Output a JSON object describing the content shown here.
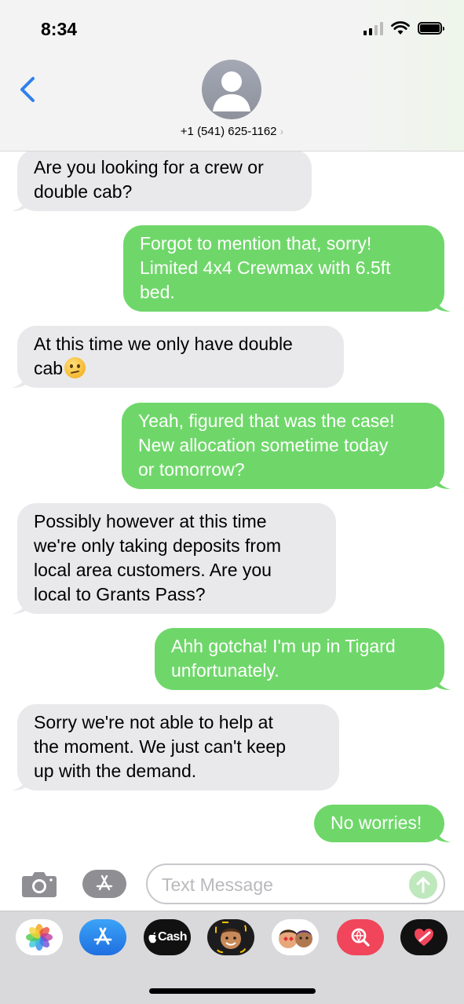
{
  "status_bar": {
    "time": "8:34"
  },
  "header": {
    "back_icon": "chevron-left-icon",
    "avatar_icon": "person-icon",
    "contact": "+1 (541) 625-1162",
    "chevron": "›"
  },
  "messages": [
    {
      "direction": "in",
      "lines": [
        "Are you looking for a crew or",
        "double cab?"
      ]
    },
    {
      "direction": "out",
      "lines": [
        "Forgot to mention that, sorry!",
        "Limited 4x4 Crewmax with 6.5ft",
        "bed."
      ]
    },
    {
      "direction": "in",
      "lines": [
        "At this time we only have double",
        "cab"
      ],
      "emoji": "confused-face-emoji"
    },
    {
      "direction": "out",
      "lines": [
        "Yeah, figured that was the case!",
        "New allocation sometime today",
        "or tomorrow?"
      ]
    },
    {
      "direction": "in",
      "lines": [
        "Possibly however at this time",
        "we're only taking deposits from",
        "local area customers. Are you",
        "local to Grants Pass?"
      ]
    },
    {
      "direction": "out",
      "lines": [
        "Ahh gotcha! I'm up in Tigard",
        "unfortunately."
      ]
    },
    {
      "direction": "in",
      "lines": [
        "Sorry we're not able to help at",
        "the moment. We just can't keep",
        "up with the demand."
      ]
    },
    {
      "direction": "out",
      "lines": [
        "No worries!"
      ]
    }
  ],
  "input": {
    "placeholder": "Text Message",
    "camera_icon": "camera-icon",
    "apps_icon": "app-store-icon",
    "send_icon": "send-arrow-icon"
  },
  "app_drawer": {
    "apps": [
      {
        "name": "photos-app-icon"
      },
      {
        "name": "app-store-app-icon"
      },
      {
        "name": "apple-cash-app-icon",
        "label": "Cash"
      },
      {
        "name": "memoji-stickers-app-icon"
      },
      {
        "name": "animoji-app-icon"
      },
      {
        "name": "web-images-search-app-icon"
      },
      {
        "name": "digital-touch-app-icon"
      }
    ]
  },
  "colors": {
    "incoming": "#e9e9eb",
    "outgoing": "#6fd76a",
    "accent": "#2f80ed"
  }
}
